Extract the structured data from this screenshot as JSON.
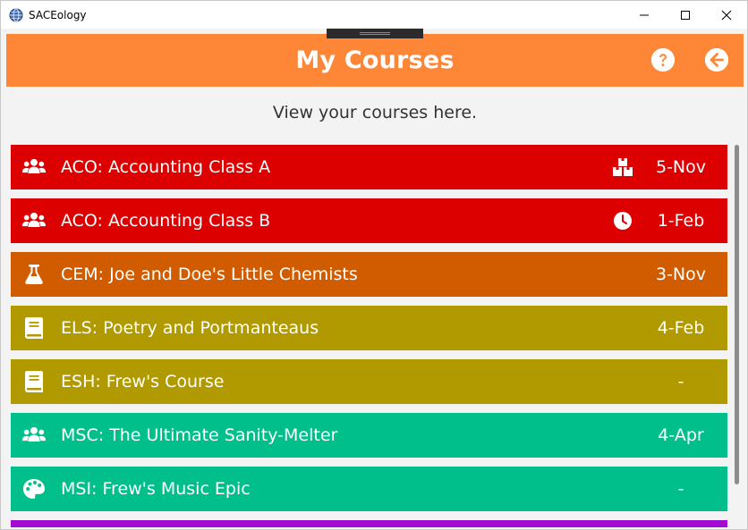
{
  "window": {
    "title": "SACEology",
    "controls": {
      "minimize": "minimize-icon",
      "maximize": "maximize-icon",
      "close": "close-icon"
    }
  },
  "header": {
    "title": "My Courses",
    "help_icon": "help-circle-icon",
    "back_icon": "back-arrow-circle-icon",
    "color": "#fd8637"
  },
  "subtitle": "View your courses here.",
  "courses": [
    {
      "code_name": "ACO: Accounting Class A",
      "icon": "users-icon",
      "status_icon": "boxes-icon",
      "date": "5-Nov",
      "color": "#dc0000"
    },
    {
      "code_name": "ACO: Accounting Class B",
      "icon": "users-icon",
      "status_icon": "clock-icon",
      "date": "1-Feb",
      "color": "#dc0000"
    },
    {
      "code_name": "CEM: Joe and Doe's Little Chemists",
      "icon": "flask-icon",
      "status_icon": "",
      "date": "3-Nov",
      "color": "#d15c00"
    },
    {
      "code_name": "ELS: Poetry and Portmanteaus",
      "icon": "book-icon",
      "status_icon": "",
      "date": "4-Feb",
      "color": "#b09a00"
    },
    {
      "code_name": "ESH: Frew's Course",
      "icon": "book-icon",
      "status_icon": "",
      "date": "-",
      "color": "#b09a00"
    },
    {
      "code_name": "MSC: The Ultimate Sanity-Melter",
      "icon": "users-icon",
      "status_icon": "",
      "date": "4-Apr",
      "color": "#00bf8b"
    },
    {
      "code_name": "MSI: Frew's Music Epic",
      "icon": "palette-icon",
      "status_icon": "",
      "date": "-",
      "color": "#00bf8b"
    }
  ],
  "next_row_color": "#a40bd1"
}
